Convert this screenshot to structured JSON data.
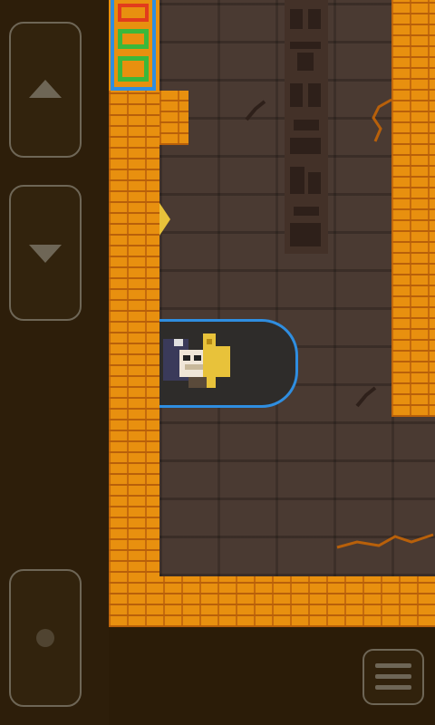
{
  "controls": {
    "up_icon": "arrow-up",
    "down_icon": "arrow-down",
    "action_icon": "action-pad",
    "menu_icon": "hamburger"
  },
  "colors": {
    "brick": "#e8900f",
    "floor": "#4a3a32",
    "highlight": "#2f8ee0",
    "panel": "#2d1e0a"
  },
  "scene": {
    "player": "explorer-with-hat",
    "wall_glyphs": "carved-hieroglyphs",
    "banner": "greek-key-banner"
  }
}
